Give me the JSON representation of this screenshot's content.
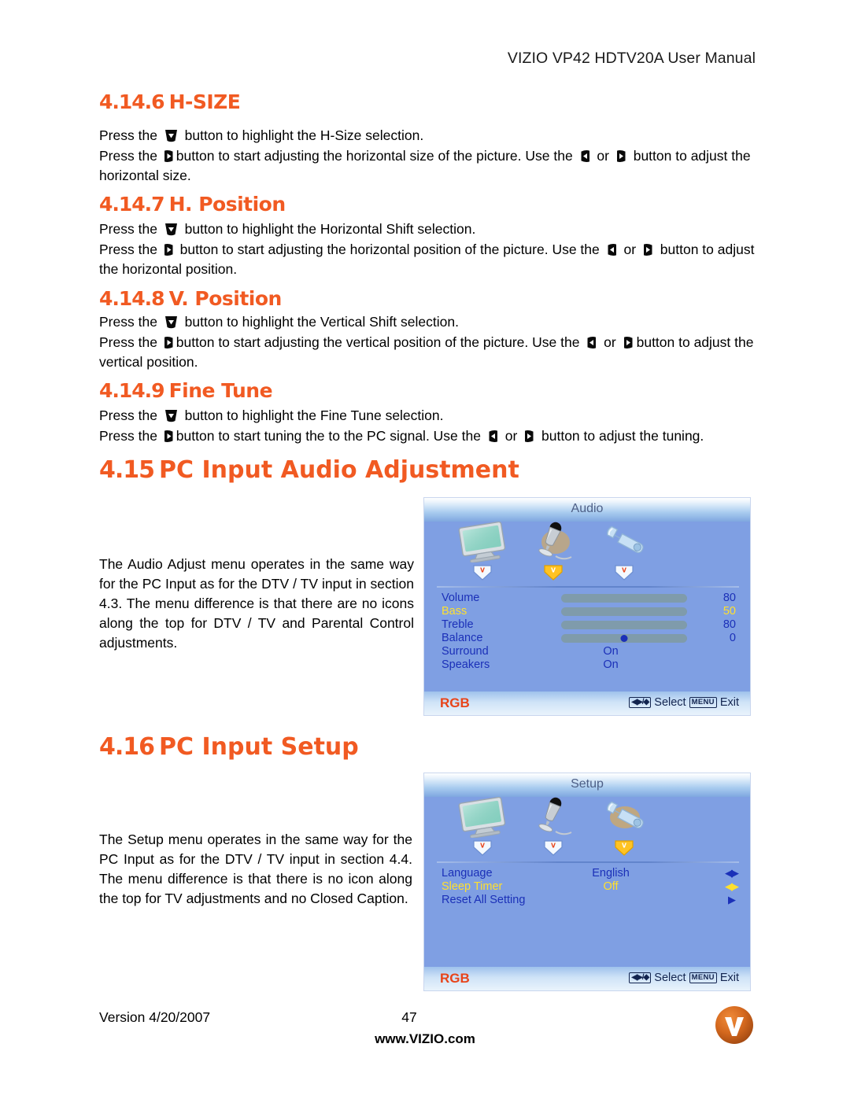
{
  "header": {
    "title": "VIZIO VP42 HDTV20A User Manual"
  },
  "sections": [
    {
      "number": "4.14.6",
      "title": "H-SIZE",
      "paragraphs": [
        {
          "pre": "Press the ",
          "mid": " button to highlight the H-Size selection.",
          "post": ""
        },
        {
          "pre": "Press the ",
          "mid": "button to start adjusting the horizontal size of the picture.  Use the ",
          "mid2": " or ",
          "post": " button to adjust the horizontal size."
        }
      ]
    },
    {
      "number": "4.14.7",
      "title": "H. Position",
      "paragraphs": [
        {
          "pre": "Press the ",
          "mid": " button to highlight the Horizontal Shift selection.",
          "post": ""
        },
        {
          "pre": "Press the ",
          "mid": " button to start adjusting the horizontal position of the picture.  Use the ",
          "mid2": " or ",
          "post": " button to adjust the horizontal position."
        }
      ]
    },
    {
      "number": "4.14.8",
      "title": "V. Position",
      "paragraphs": [
        {
          "pre": "Press the ",
          "mid": " button to highlight the Vertical Shift selection.",
          "post": ""
        },
        {
          "pre": "Press the ",
          "mid": "button to start adjusting the vertical position of the picture.  Use the ",
          "mid2": " or ",
          "post": "button to adjust the vertical position."
        }
      ]
    },
    {
      "number": "4.14.9",
      "title": "Fine Tune",
      "paragraphs": [
        {
          "pre": "Press the ",
          "mid": " button to highlight the Fine Tune selection.",
          "post": ""
        },
        {
          "pre": "Press the ",
          "mid": "button to start tuning the to the PC signal.  Use the ",
          "mid2": " or ",
          "post": " button to adjust the tuning."
        }
      ]
    }
  ],
  "audio_section": {
    "number": "4.15",
    "title": "PC Input Audio Adjustment",
    "body": "The Audio Adjust menu operates in the same way for the PC Input as for the DTV / TV input in section 4.3.  The menu difference is that there are no icons along the top for DTV / TV and Parental Control adjustments."
  },
  "setup_section": {
    "number": "4.16",
    "title": "PC Input Setup",
    "body": "The Setup menu operates in the same way for the PC Input as for the DTV / TV input in section 4.4.  The menu difference is that there is no icon along the top for TV adjustments and no Closed Caption."
  },
  "audio_osd": {
    "title": "Audio",
    "icons": [
      {
        "name": "monitor-icon",
        "selected": false
      },
      {
        "name": "microphone-icon",
        "selected": true
      },
      {
        "name": "wrench-icon",
        "selected": false
      }
    ],
    "rows": [
      {
        "label": "Volume",
        "type": "slider",
        "value": "80",
        "percent": 84,
        "fill": "#1b1ff0",
        "highlight": false
      },
      {
        "label": "Bass",
        "type": "slider",
        "value": "50",
        "percent": 50,
        "fill": "#f2e63a",
        "highlight": true
      },
      {
        "label": "Treble",
        "type": "slider",
        "value": "80",
        "percent": 84,
        "fill": "#1b1ff0",
        "highlight": false
      },
      {
        "label": "Balance",
        "type": "dot",
        "value": "0",
        "percent": 50,
        "fill": "#1b30b8",
        "highlight": false
      },
      {
        "label": "Surround",
        "type": "text",
        "value": "On",
        "highlight": false
      },
      {
        "label": "Speakers",
        "type": "text",
        "value": "On",
        "highlight": false
      }
    ],
    "footer": {
      "source": "RGB",
      "select_label": "Select",
      "menu_key": "MENU",
      "exit_label": "Exit"
    }
  },
  "setup_osd": {
    "title": "Setup",
    "icons": [
      {
        "name": "monitor-icon",
        "selected": false
      },
      {
        "name": "microphone-icon",
        "selected": false
      },
      {
        "name": "wrench-icon",
        "selected": true
      }
    ],
    "rows": [
      {
        "label": "Language",
        "value": "English",
        "arrow": "both",
        "highlight": false
      },
      {
        "label": "Sleep  Timer",
        "value": "Off",
        "arrow": "both",
        "highlight": true
      },
      {
        "label": "Reset  All  Setting",
        "value": "",
        "arrow": "right",
        "highlight": false
      }
    ],
    "footer": {
      "source": "RGB",
      "select_label": "Select",
      "menu_key": "MENU",
      "exit_label": "Exit"
    }
  },
  "footer": {
    "version": "Version 4/20/2007",
    "page": "47",
    "url": "www.VIZIO.com",
    "logo_letter": "V"
  },
  "colors": {
    "heading_orange": "#F15A22",
    "osd_body_blue": "#7f9fe3",
    "osd_text_blue": "#1b30b8",
    "osd_highlight_yellow": "#ffe02e",
    "rgb_red": "#E8441A",
    "logo_orange": "#D4681E"
  }
}
